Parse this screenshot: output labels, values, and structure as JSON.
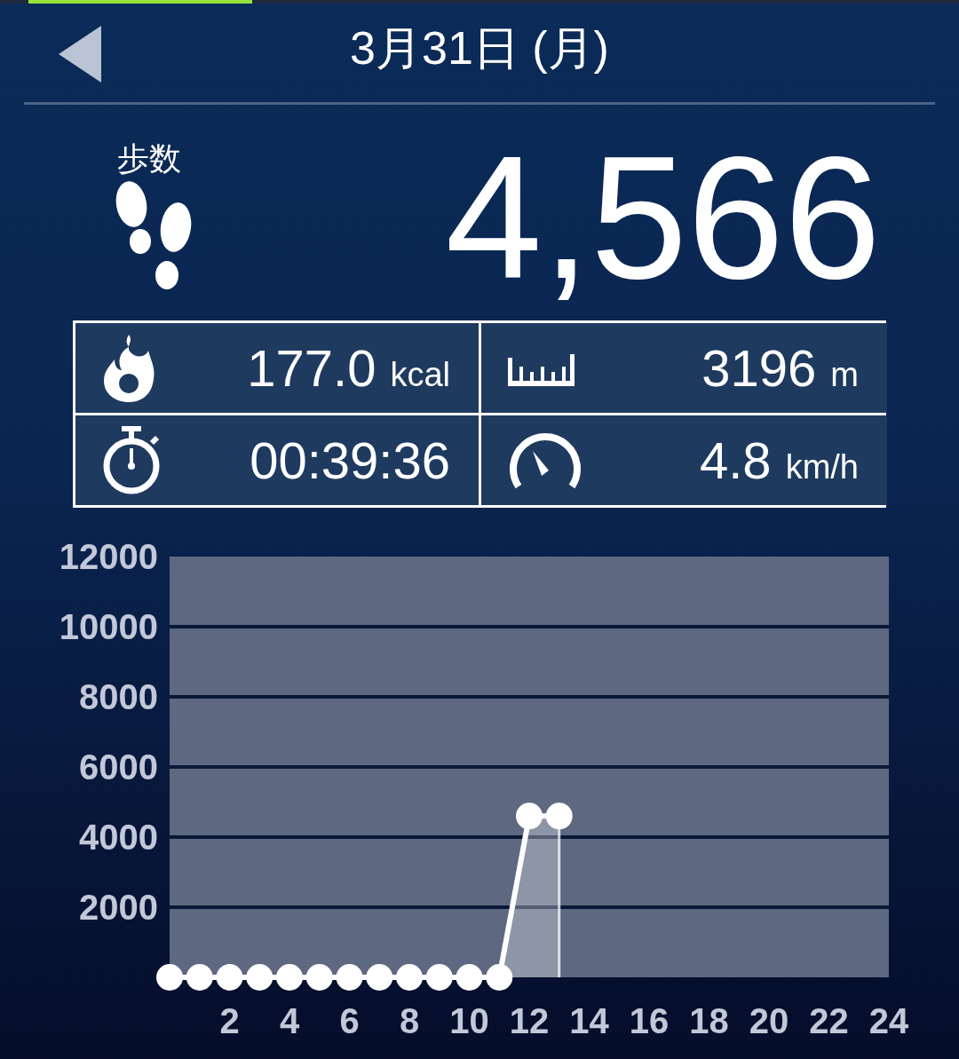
{
  "header": {
    "title": "3月31日 (月)"
  },
  "steps": {
    "label": "歩数",
    "value": "4,566"
  },
  "stats": [
    {
      "kind": "calories",
      "value": "177.0",
      "unit": "kcal"
    },
    {
      "kind": "distance",
      "value": "3196",
      "unit": "m"
    },
    {
      "kind": "time",
      "value": "00:39:36"
    },
    {
      "kind": "speed",
      "value": "4.8",
      "unit": "km/h"
    }
  ],
  "chart_data": {
    "type": "area",
    "x": [
      0,
      1,
      2,
      3,
      4,
      5,
      6,
      7,
      8,
      9,
      10,
      11,
      12,
      13
    ],
    "series": [
      {
        "color": "#ffffff",
        "values": [
          0,
          0,
          0,
          0,
          0,
          0,
          0,
          0,
          0,
          0,
          0,
          0,
          4600,
          4600
        ]
      }
    ],
    "grid": true,
    "xlim": [
      0,
      24
    ],
    "ylim": [
      0,
      12000
    ],
    "xticks": [
      2,
      4,
      6,
      8,
      10,
      12,
      14,
      16,
      18,
      20,
      22,
      24
    ],
    "yticks": [
      2000,
      4000,
      6000,
      8000,
      10000,
      12000
    ]
  }
}
